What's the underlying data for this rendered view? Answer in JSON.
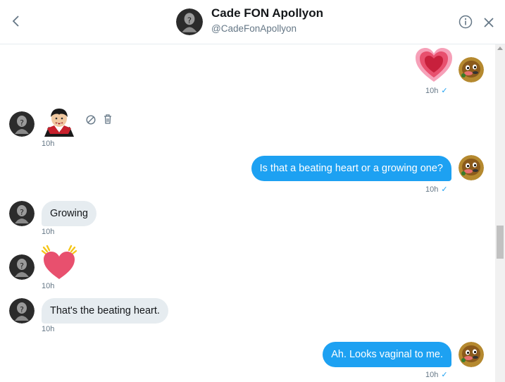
{
  "header": {
    "name": "Cade FON Apollyon",
    "handle": "@CadeFonApollyon",
    "back_icon": "chevron-left-icon",
    "info_icon": "info-circle-icon",
    "close_icon": "close-icon"
  },
  "colors": {
    "outgoing_bubble": "#1da1f2",
    "incoming_bubble": "#e6ecf0",
    "timestamp": "#657786",
    "read_check": "#1da1f2"
  },
  "messages": [
    {
      "direction": "out",
      "type": "emoji",
      "emoji": "growing-heart",
      "time": "10h",
      "read_mark": "✓"
    },
    {
      "direction": "in",
      "type": "emoji",
      "emoji": "vampire",
      "time": "10h",
      "actions": [
        "block-icon",
        "trash-icon"
      ]
    },
    {
      "direction": "out",
      "type": "text",
      "text": "Is that a beating heart or a growing one?",
      "time": "10h",
      "read_mark": "✓"
    },
    {
      "direction": "in",
      "type": "text",
      "text": "Growing",
      "time": "10h"
    },
    {
      "direction": "in",
      "type": "emoji",
      "emoji": "beating-heart",
      "time": "10h"
    },
    {
      "direction": "in",
      "type": "text",
      "text": "That's the beating heart.",
      "time": "10h"
    },
    {
      "direction": "out",
      "type": "text",
      "text": "Ah. Looks vaginal to me.",
      "time": "10h",
      "read_mark": "✓"
    }
  ]
}
